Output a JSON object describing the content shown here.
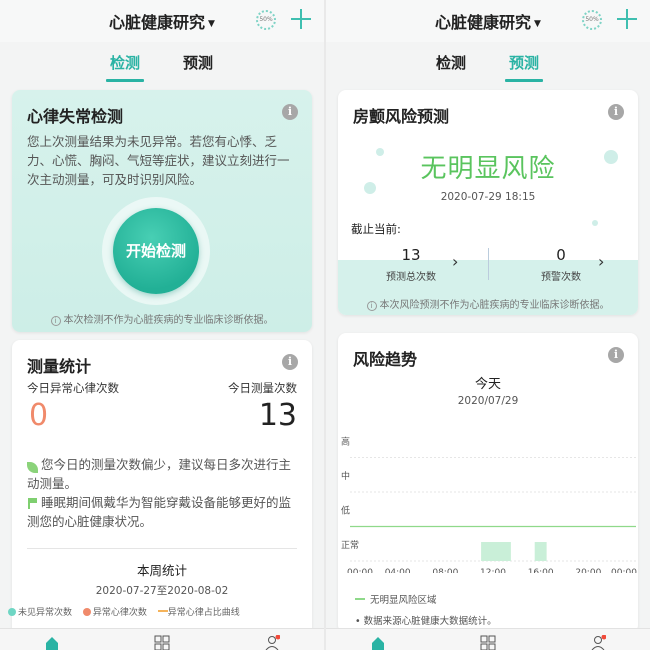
{
  "topbar": {
    "title": "心脏健康研究",
    "ring_label": "50%"
  },
  "tabs": {
    "detect": "检测",
    "predict": "预测"
  },
  "detect_card": {
    "title": "心律失常检测",
    "description": "您上次测量结果为未见异常。若您有心悸、乏力、心慌、胸闷、气短等症状，建议立刻进行一次主动测量，可及时识别风险。",
    "start_button": "开始检测",
    "disclaimer": "本次检测不作为心脏疾病的专业临床诊断依据。"
  },
  "stats_card": {
    "title": "测量统计",
    "abnormal_label": "今日异常心律次数",
    "abnormal_count": "0",
    "measure_label": "今日测量次数",
    "measure_count": "13",
    "tip1": "您今日的测量次数偏少，建议每日多次进行主动测量。",
    "tip2": "睡眠期间佩戴华为智能穿戴设备能够更好的监测您的心脏健康状况。",
    "week_title": "本周统计",
    "week_range": "2020-07-27至2020-08-02",
    "legend": [
      "未见异常次数",
      "异常心律次数",
      "异常心律占比曲线"
    ]
  },
  "predict_card": {
    "title": "房颤风险预测",
    "risk": "无明显风险",
    "time": "2020-07-29 18:15",
    "as_of": "截止当前:",
    "predict_count": "13",
    "predict_label": "预测总次数",
    "warn_count": "0",
    "warn_label": "预警次数",
    "disclaimer": "本次风险预测不作为心脏疾病的专业临床诊断依据。"
  },
  "trend_card": {
    "title": "风险趋势",
    "day": "今天",
    "date": "2020/07/29",
    "levels": [
      "高",
      "中",
      "低",
      "正常"
    ],
    "xticks": [
      "00:00",
      "04:00",
      "08:00",
      "12:00",
      "16:00",
      "20:00",
      "00:00"
    ],
    "legend": "无明显风险区域",
    "note": "数据来源心脏健康大数据统计。"
  },
  "colors": {
    "accent": "#2ab3a4",
    "risk_green": "#5ac45e",
    "abnormal_zero": "#f08a6b"
  },
  "chart_data": {
    "type": "area",
    "title": "风险趋势",
    "x_ticks": [
      "00:00",
      "04:00",
      "08:00",
      "12:00",
      "16:00",
      "20:00",
      "00:00"
    ],
    "y_categories": [
      "正常",
      "低",
      "中",
      "高"
    ],
    "series": [
      {
        "name": "无明显风险区域",
        "segments": [
          {
            "start": "11:00",
            "end": "13:30",
            "level": "正常"
          },
          {
            "start": "15:30",
            "end": "16:30",
            "level": "正常"
          }
        ]
      }
    ]
  }
}
